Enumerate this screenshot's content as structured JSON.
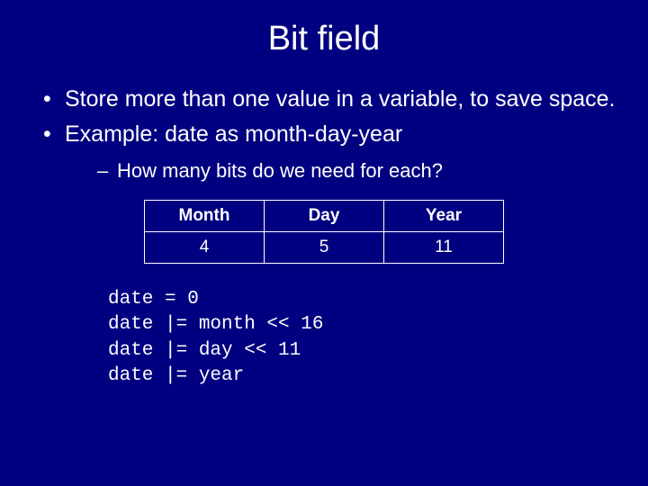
{
  "title": "Bit field",
  "bullets": {
    "b1": "Store more than one value in a variable, to save space.",
    "b2": "Example:  date as month-day-year",
    "b2_sub1": "How many bits do we need for each?"
  },
  "table": {
    "headers": {
      "c1": "Month",
      "c2": "Day",
      "c3": "Year"
    },
    "row1": {
      "c1": "4",
      "c2": "5",
      "c3": "11"
    }
  },
  "code": {
    "l1": "date = 0",
    "l2": "date |= month << 16",
    "l3": "date |= day << 11",
    "l4": "date |= year"
  }
}
